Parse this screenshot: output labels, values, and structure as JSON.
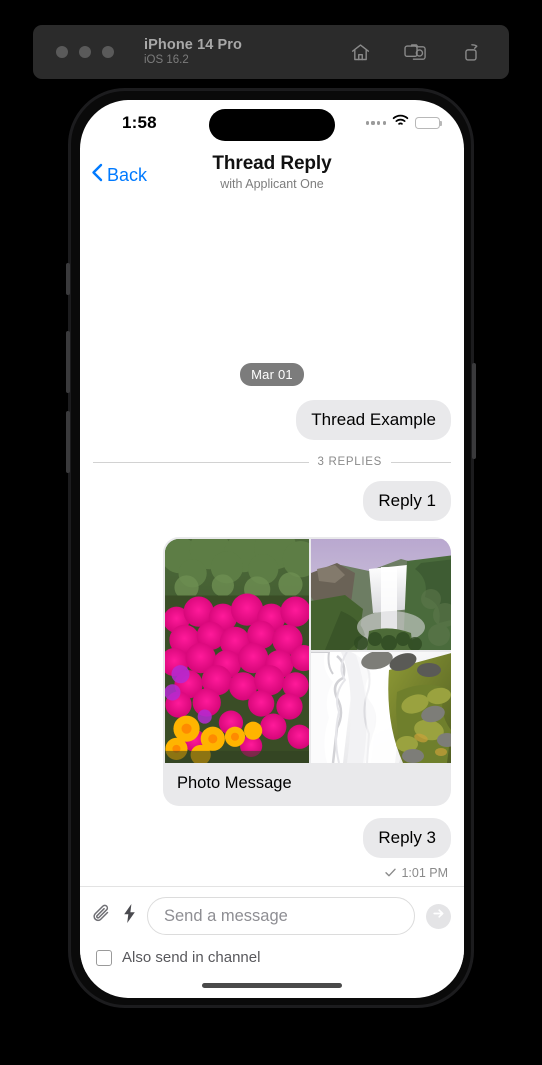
{
  "simulator": {
    "device_name": "iPhone 14 Pro",
    "os_version": "iOS 16.2",
    "toolbar_icons": [
      "home-icon",
      "screenshot-icon",
      "record-icon"
    ]
  },
  "status_bar": {
    "time": "1:58",
    "cellular": "signal-dots-icon",
    "wifi": "wifi-icon",
    "battery": "battery-icon"
  },
  "nav": {
    "back_label": "Back",
    "back_icon": "chevron-left-icon",
    "title": "Thread Reply",
    "subtitle": "with Applicant One"
  },
  "conversation": {
    "date_pill": "Mar 01",
    "parent_message": "Thread Example",
    "divider_label": "3 REPLIES",
    "reply_one": "Reply 1",
    "photo_caption": "Photo Message",
    "photos": [
      "pink-flowers-photo",
      "waterfall-cliff-photo",
      "mossy-cascade-photo"
    ],
    "reply_three": "Reply 3",
    "receipt_icon": "check-icon",
    "receipt_time": "1:01 PM"
  },
  "composer": {
    "attach_icon": "paperclip-icon",
    "shortcut_icon": "lightning-bolt-icon",
    "input_value": "",
    "placeholder": "Send a message",
    "send_icon": "send-arrow-icon",
    "channel_checkbox_checked": false,
    "channel_label": "Also send in channel"
  },
  "colors": {
    "accent": "#007AFF",
    "bubble": "#e9e9eb",
    "date_pill": "#7c7c7c",
    "sim_bar": "#2b2b2b"
  }
}
